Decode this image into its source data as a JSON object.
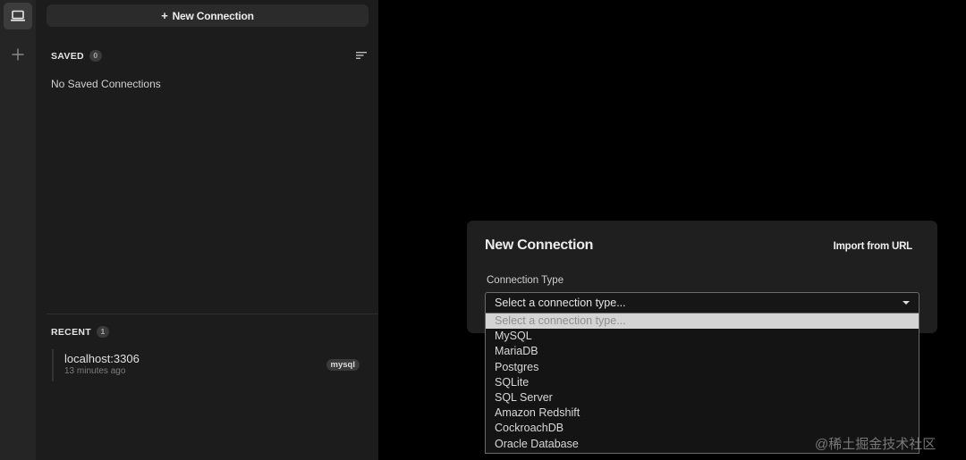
{
  "rail": {
    "items": [
      {
        "name": "connections",
        "icon": "laptop-icon"
      },
      {
        "name": "add",
        "icon": "plus-icon"
      }
    ]
  },
  "sidebar": {
    "new_button": {
      "icon": "+",
      "label": "New Connection"
    },
    "saved": {
      "title": "SAVED",
      "count": "0",
      "empty_text": "No Saved Connections",
      "sort_icon": "sort-icon"
    },
    "recent": {
      "title": "RECENT",
      "count": "1",
      "items": [
        {
          "name": "localhost:3306",
          "time": "13 minutes ago",
          "type": "mysql"
        }
      ]
    }
  },
  "panel": {
    "title": "New Connection",
    "import_link": "Import from URL",
    "connection_type_label": "Connection Type",
    "select_value": "Select a connection type...",
    "options": [
      "Select a connection type...",
      "MySQL",
      "MariaDB",
      "Postgres",
      "SQLite",
      "SQL Server",
      "Amazon Redshift",
      "CockroachDB",
      "Oracle Database"
    ]
  },
  "watermark": "@稀土掘金技术社区",
  "colors": {
    "background": "#000000",
    "sidebar": "#1c1c1c",
    "rail": "#252525",
    "panel": "#1f1f1f",
    "highlight": "#d4d4d4"
  }
}
